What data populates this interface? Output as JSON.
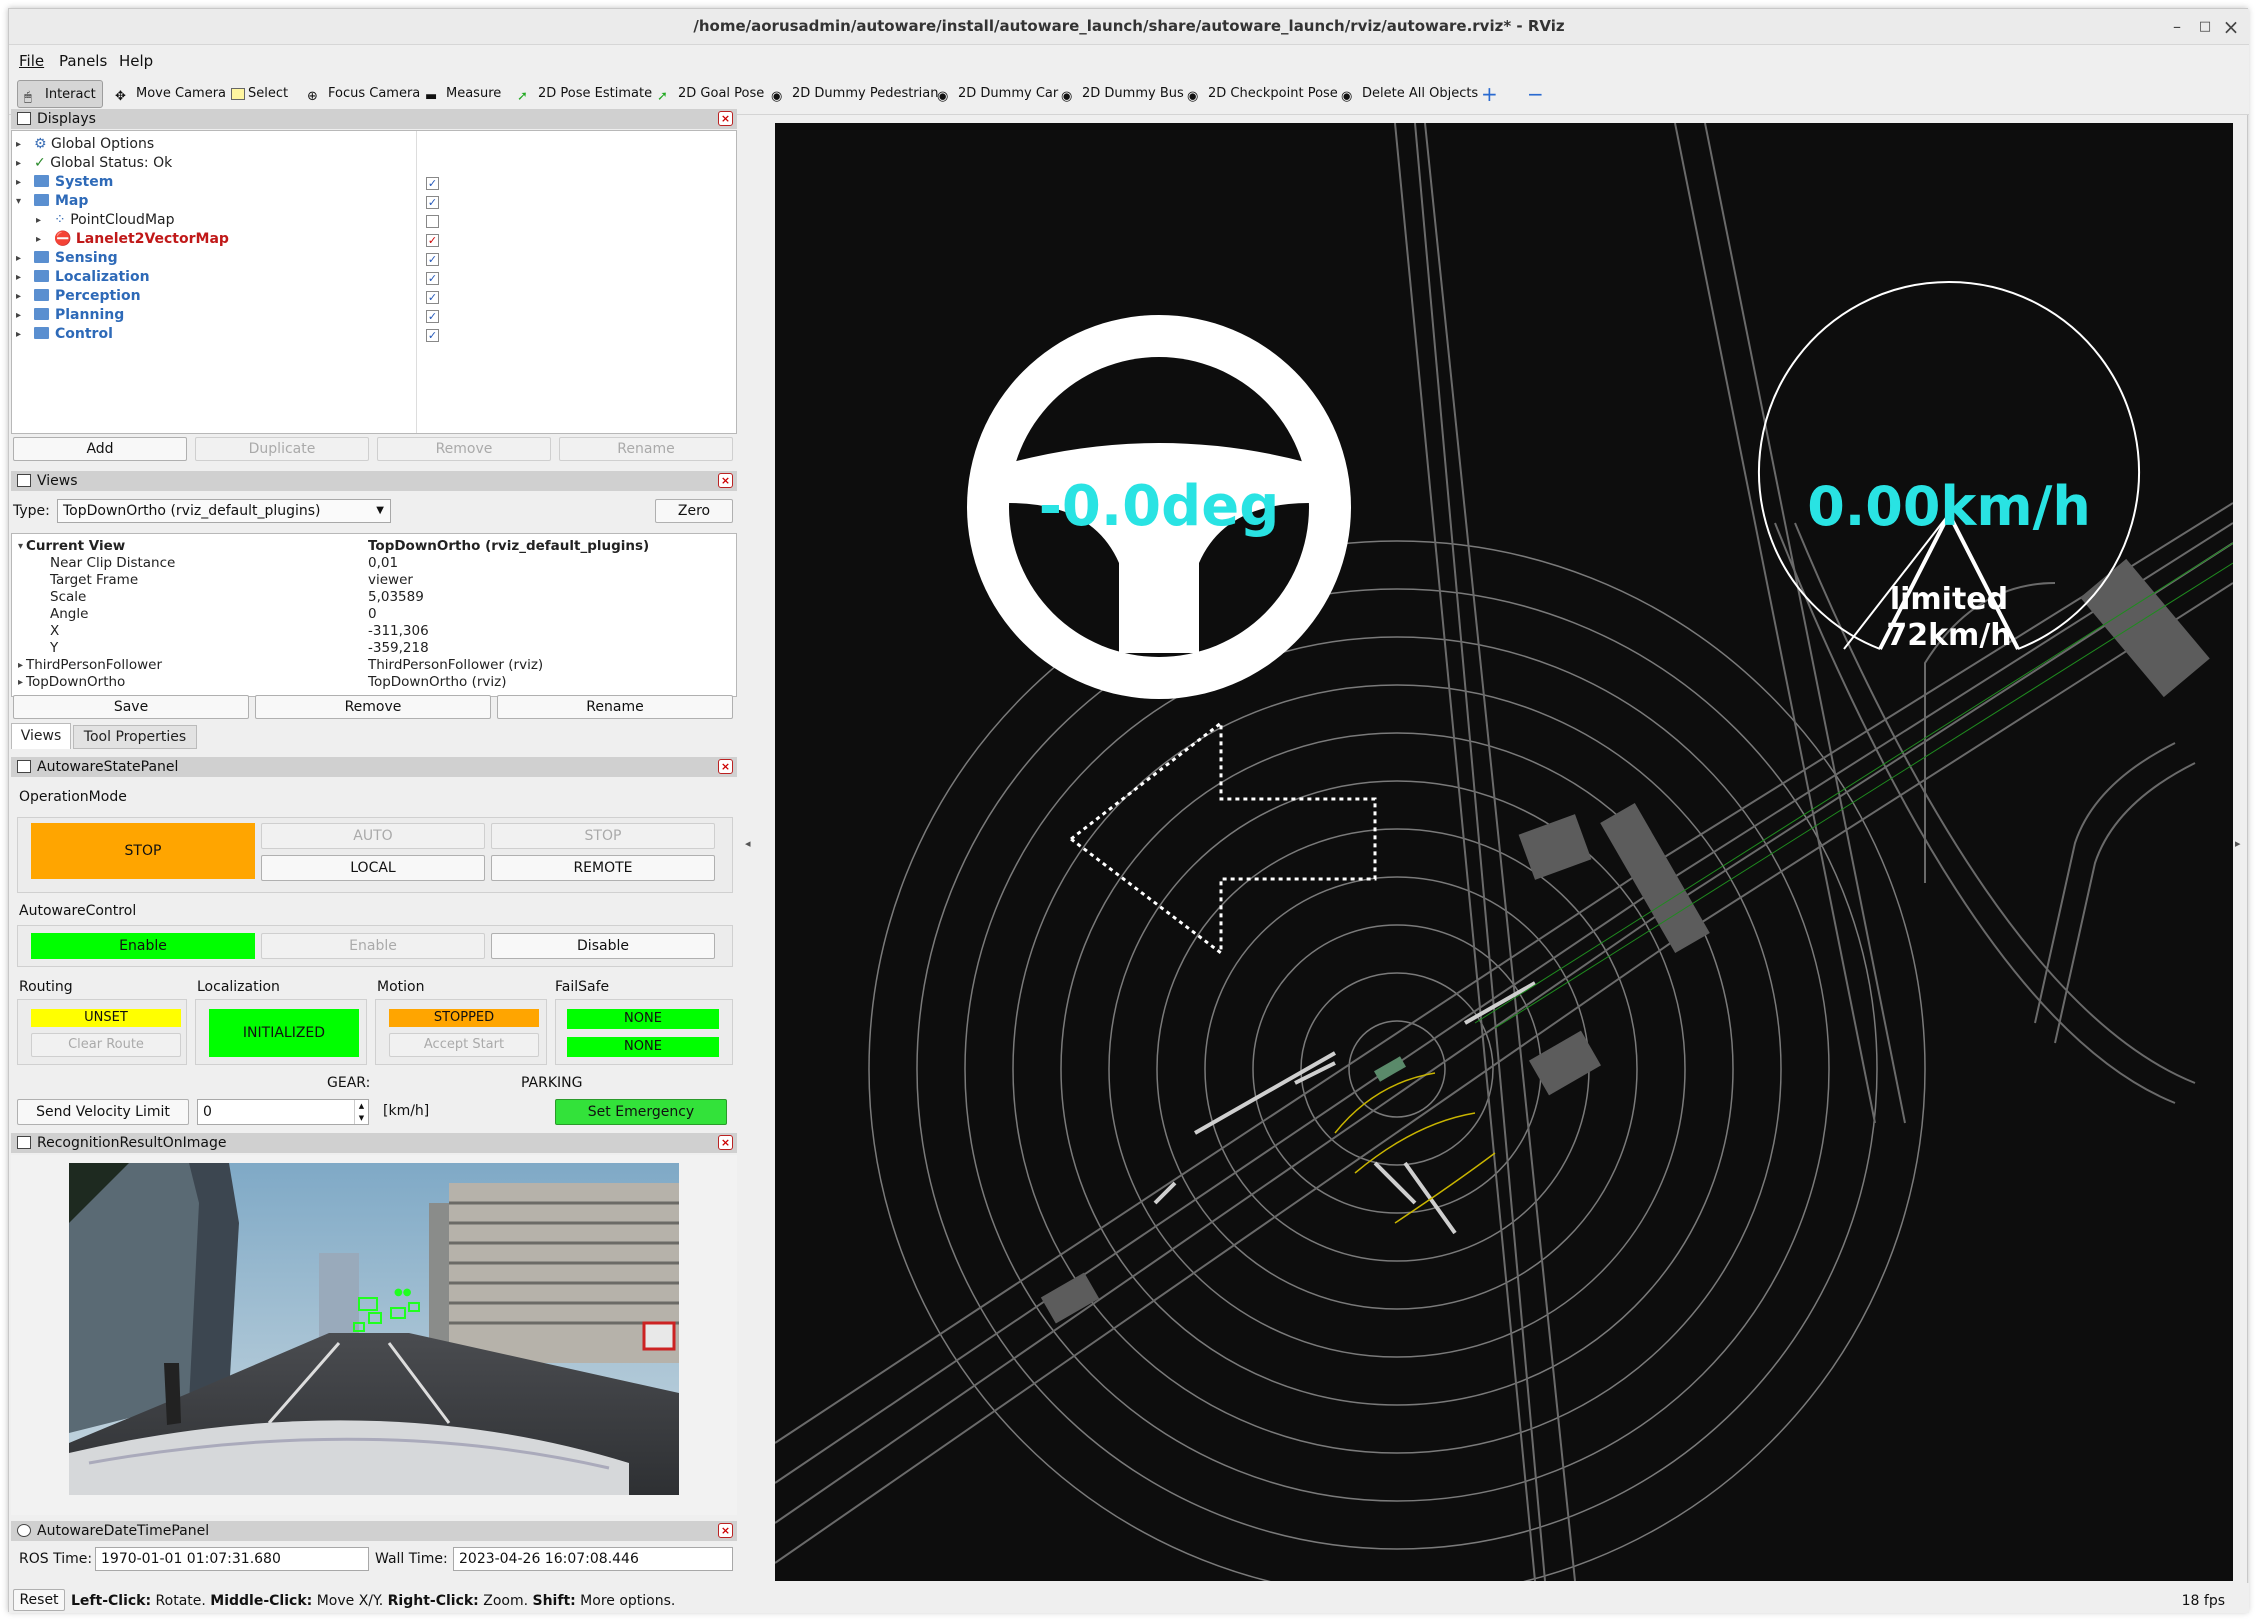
{
  "window": {
    "title": "/home/aorusadmin/autoware/install/autoware_launch/share/autoware_launch/rviz/autoware.rviz* - RViz",
    "minimize": "–",
    "maximize": "□",
    "close": "×"
  },
  "menu": {
    "file": "File",
    "panels": "Panels",
    "help": "Help"
  },
  "toolbar": {
    "interact": "Interact",
    "move_camera": "Move Camera",
    "select": "Select",
    "focus_camera": "Focus Camera",
    "measure": "Measure",
    "pose_estimate": "2D Pose Estimate",
    "goal_pose": "2D Goal Pose",
    "dummy_pedestrian": "2D Dummy Pedestrian",
    "dummy_car": "2D Dummy Car",
    "dummy_bus": "2D Dummy Bus",
    "checkpoint_pose": "2D Checkpoint Pose",
    "delete_all": "Delete All Objects",
    "plus": "+",
    "minus": "−"
  },
  "displays": {
    "title": "Displays",
    "items": [
      {
        "label": "Global Options"
      },
      {
        "label": "Global Status: Ok"
      },
      {
        "label": "System"
      },
      {
        "label": "Map"
      },
      {
        "label": "PointCloudMap"
      },
      {
        "label": "Lanelet2VectorMap"
      },
      {
        "label": "Sensing"
      },
      {
        "label": "Localization"
      },
      {
        "label": "Perception"
      },
      {
        "label": "Planning"
      },
      {
        "label": "Control"
      }
    ],
    "add": "Add",
    "duplicate": "Duplicate",
    "remove": "Remove",
    "rename": "Rename"
  },
  "views": {
    "title": "Views",
    "type_label": "Type:",
    "type_value": "TopDownOrtho (rviz_default_plugins)",
    "zero": "Zero",
    "props": [
      {
        "k": "Current View",
        "v": "TopDownOrtho (rviz_default_plugins)"
      },
      {
        "k": "Near Clip Distance",
        "v": "0,01"
      },
      {
        "k": "Target Frame",
        "v": "viewer"
      },
      {
        "k": "Scale",
        "v": "5,03589"
      },
      {
        "k": "Angle",
        "v": "0"
      },
      {
        "k": "X",
        "v": "-311,306"
      },
      {
        "k": "Y",
        "v": "-359,218"
      },
      {
        "k": "ThirdPersonFollower",
        "v": "ThirdPersonFollower (rviz)"
      },
      {
        "k": "TopDownOrtho",
        "v": "TopDownOrtho (rviz)"
      }
    ],
    "save": "Save",
    "remove": "Remove",
    "rename": "Rename",
    "tab_views": "Views",
    "tab_tool": "Tool Properties"
  },
  "state": {
    "title": "AutowareStatePanel",
    "operation_mode": "OperationMode",
    "stop_status": "STOP",
    "auto": "AUTO",
    "stop_btn": "STOP",
    "local": "LOCAL",
    "remote": "REMOTE",
    "autoware_control": "AutowareControl",
    "enable_status": "Enable",
    "enable_btn": "Enable",
    "disable": "Disable",
    "routing": "Routing",
    "routing_status": "UNSET",
    "clear_route": "Clear Route",
    "localization": "Localization",
    "localization_status": "INITIALIZED",
    "motion": "Motion",
    "motion_status": "STOPPED",
    "accept_start": "Accept Start",
    "failsafe": "FailSafe",
    "failsafe_1": "NONE",
    "failsafe_2": "NONE",
    "gear": "GEAR:",
    "parking": "PARKING",
    "send_velocity": "Send Velocity Limit",
    "velocity_value": "0",
    "unit": "[km/h]",
    "emergency": "Set Emergency",
    "colors": {
      "stop": "#ffa500",
      "ok": "#00ff00",
      "unset": "#ffff00"
    }
  },
  "recognition": {
    "title": "RecognitionResultOnImage"
  },
  "datetime": {
    "title": "AutowareDateTimePanel",
    "ros_label": "ROS Time:",
    "ros_value": "1970-01-01 01:07:31.680",
    "wall_label": "Wall Time:",
    "wall_value": "2023-04-26 16:07:08.446"
  },
  "status": {
    "reset": "Reset",
    "hint_lc": "Left-Click:",
    "hint_lc_v": " Rotate. ",
    "hint_mc": "Middle-Click:",
    "hint_mc_v": " Move X/Y. ",
    "hint_rc": "Right-Click:",
    "hint_rc_v": " Zoom. ",
    "hint_sh": "Shift:",
    "hint_sh_v": " More options.",
    "fps": "18 fps"
  },
  "viewport": {
    "steering": "-0.0deg",
    "speed": "0.00km/h",
    "limit_1": "limited",
    "limit_2": "72km/h",
    "hud_color": "#29e3e3"
  }
}
